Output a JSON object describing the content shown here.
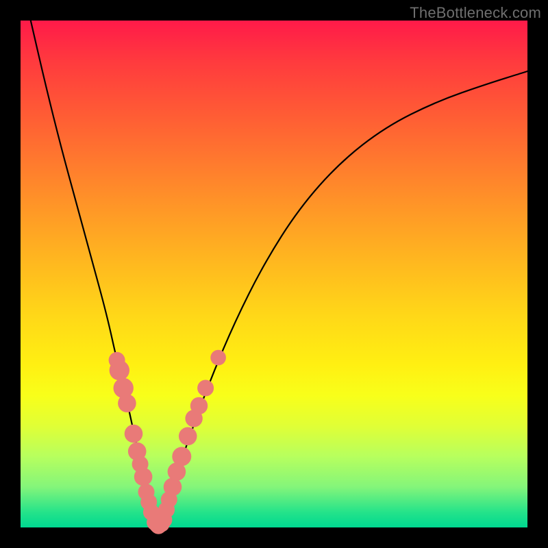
{
  "watermark": "TheBottleneck.com",
  "chart_data": {
    "type": "line",
    "title": "",
    "xlabel": "",
    "ylabel": "",
    "xlim": [
      0,
      100
    ],
    "ylim": [
      0,
      100
    ],
    "annotations": [],
    "series": [
      {
        "name": "bottleneck-curve",
        "x": [
          2,
          5,
          8,
          11,
          14,
          17,
          19,
          21,
          22.5,
          24,
          25,
          26,
          27,
          28,
          30,
          33,
          37,
          42,
          48,
          55,
          63,
          72,
          82,
          92,
          100
        ],
        "values": [
          100,
          87,
          75,
          64,
          53,
          42,
          33,
          25,
          18,
          11,
          6,
          2,
          0,
          2,
          8,
          17,
          28,
          40,
          52,
          63,
          72,
          79,
          84,
          87.5,
          90
        ]
      }
    ],
    "markers": {
      "name": "highlighted-points",
      "color": "#e97a78",
      "points": [
        {
          "x": 19.0,
          "y": 33.0,
          "r": 1.2
        },
        {
          "x": 19.5,
          "y": 31.0,
          "r": 1.6
        },
        {
          "x": 20.3,
          "y": 27.5,
          "r": 1.6
        },
        {
          "x": 21.0,
          "y": 24.5,
          "r": 1.4
        },
        {
          "x": 22.3,
          "y": 18.5,
          "r": 1.4
        },
        {
          "x": 23.0,
          "y": 15.0,
          "r": 1.4
        },
        {
          "x": 23.6,
          "y": 12.5,
          "r": 1.2
        },
        {
          "x": 24.2,
          "y": 10.0,
          "r": 1.4
        },
        {
          "x": 24.8,
          "y": 7.0,
          "r": 1.2
        },
        {
          "x": 25.3,
          "y": 5.0,
          "r": 1.2
        },
        {
          "x": 25.8,
          "y": 3.0,
          "r": 1.2
        },
        {
          "x": 26.5,
          "y": 1.0,
          "r": 1.2
        },
        {
          "x": 27.0,
          "y": 0.5,
          "r": 1.2
        },
        {
          "x": 27.2,
          "y": 0.3,
          "r": 1.2
        },
        {
          "x": 27.8,
          "y": 0.7,
          "r": 1.2
        },
        {
          "x": 28.3,
          "y": 1.5,
          "r": 1.2
        },
        {
          "x": 28.8,
          "y": 3.5,
          "r": 1.2
        },
        {
          "x": 29.3,
          "y": 5.5,
          "r": 1.2
        },
        {
          "x": 30.0,
          "y": 8.0,
          "r": 1.4
        },
        {
          "x": 30.8,
          "y": 11.0,
          "r": 1.4
        },
        {
          "x": 31.8,
          "y": 14.0,
          "r": 1.5
        },
        {
          "x": 33.0,
          "y": 18.0,
          "r": 1.4
        },
        {
          "x": 34.2,
          "y": 21.5,
          "r": 1.3
        },
        {
          "x": 35.2,
          "y": 24.0,
          "r": 1.3
        },
        {
          "x": 36.5,
          "y": 27.5,
          "r": 1.2
        },
        {
          "x": 39.0,
          "y": 33.5,
          "r": 1.1
        }
      ]
    }
  }
}
